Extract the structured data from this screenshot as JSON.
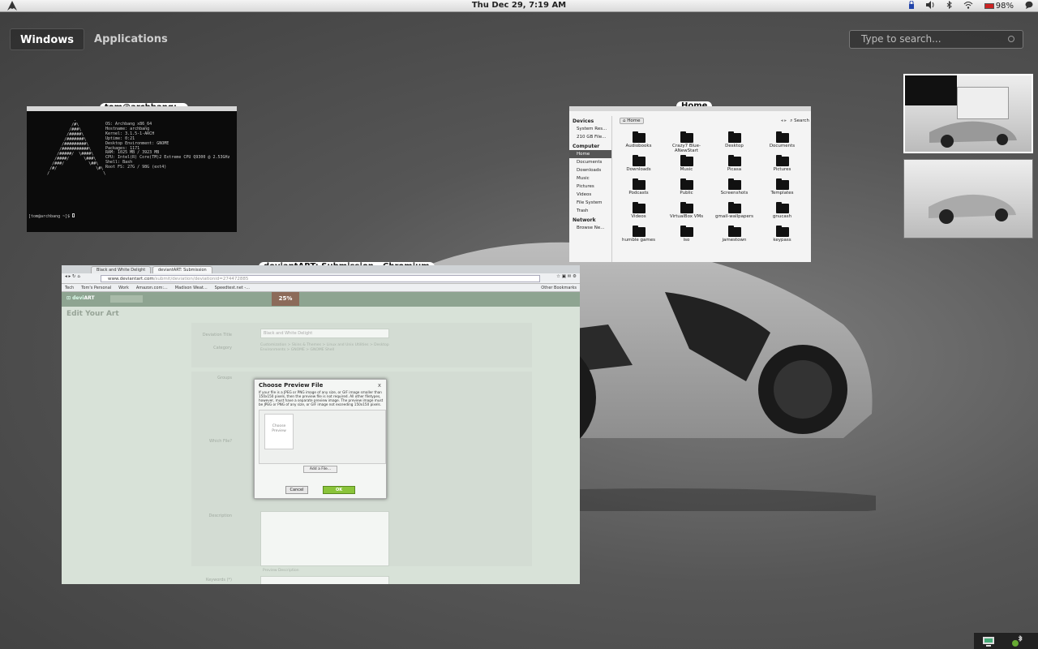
{
  "top_panel": {
    "clock": "Thu Dec 29,  7:19 AM",
    "battery": "98%"
  },
  "overview": {
    "tabs": [
      {
        "label": "Windows",
        "active": true
      },
      {
        "label": "Applications",
        "active": false
      }
    ],
    "search_placeholder": "Type to search..."
  },
  "windows": {
    "terminal": {
      "title": "tom@archbang:~",
      "info_lines": [
        "OS: Archbang x86_64",
        "Hostname: archbang",
        "Kernel: 3.1.5-1-ARCH",
        "Uptime: 0:21",
        "Desktop Environment: GNOME",
        "Packages: 1171",
        "RAM: 1025 MB / 3923 MB",
        "CPU: Intel(R) Core(TM)2 Extreme CPU Q9300 @ 2.53GHz",
        "Shell: Bash",
        "Root FS: 27G / 98G (ext4)"
      ],
      "prompt": "[tom@archbang ~]$ "
    },
    "files": {
      "title": "Home",
      "crumb": "Home",
      "search_label": "Search",
      "sidebar": [
        {
          "section": "Devices",
          "items": [
            "System Res...",
            "210 GB File..."
          ]
        },
        {
          "section": "Computer",
          "items": [
            "Home",
            "Documents",
            "Downloads",
            "Music",
            "Pictures",
            "Videos",
            "File System",
            "Trash"
          ]
        },
        {
          "section": "Network",
          "items": [
            "Browse Ne..."
          ]
        }
      ],
      "selected": "Home",
      "folders": [
        "Audiobooks",
        "Crazy7 Blue-ANewStart",
        "Desktop",
        "Documents",
        "Downloads",
        "Music",
        "Picasa",
        "Pictures",
        "Podcasts",
        "Public",
        "Screenshots",
        "Templates",
        "Videos",
        "VirtualBox VMs",
        "gmail-wallpapers",
        "gnucash",
        "humble games",
        "iso",
        "jamestown",
        "keypass"
      ]
    },
    "chromium": {
      "title": "deviantART: Submission - Chromium",
      "tabs": [
        "Black and White Delight",
        "deviantART: Submission"
      ],
      "url_host": "www.deviantart.com",
      "url_path": "/submit/deviation/deviationid=274472885",
      "bookmarks": [
        "Tech",
        "Tom's Personal",
        "Work",
        "Amazon.com:...",
        "Madison Weat...",
        "Speedtest.net -..."
      ],
      "other_bookmarks": "Other Bookmarks",
      "promo": "25% OFF",
      "page_title": "Edit Your Art",
      "labels": [
        "Deviation Title",
        "Category",
        "Groups",
        "Which File?",
        "Description",
        "Keywords (*)"
      ],
      "deviation_title_value": "Black and White Delight",
      "category_path": "Customization > Skins & Themes > Linux and Unix Utilities > Desktop Environments > GNOME > GNOME Shell",
      "preview_description": "Preview Description",
      "dialog": {
        "title": "Choose Preview File",
        "close": "x",
        "text": "If your file is a JPEG or PNG image of any size, or GIF image smaller than 150x150 pixels, then the preview file is not required. All other filetypes, however, must have a separate preview image. The preview image must be JPEG or PNG of any size, or GIF image not exceeding 150x150 pixels.",
        "preview_placeholder": "Choose Preview",
        "add_file": "Add a File...",
        "cancel": "Cancel",
        "ok": "OK"
      }
    }
  },
  "colors": {
    "background": "#565656",
    "ok_button": "#8ac43a",
    "battery": "#cc2222"
  }
}
